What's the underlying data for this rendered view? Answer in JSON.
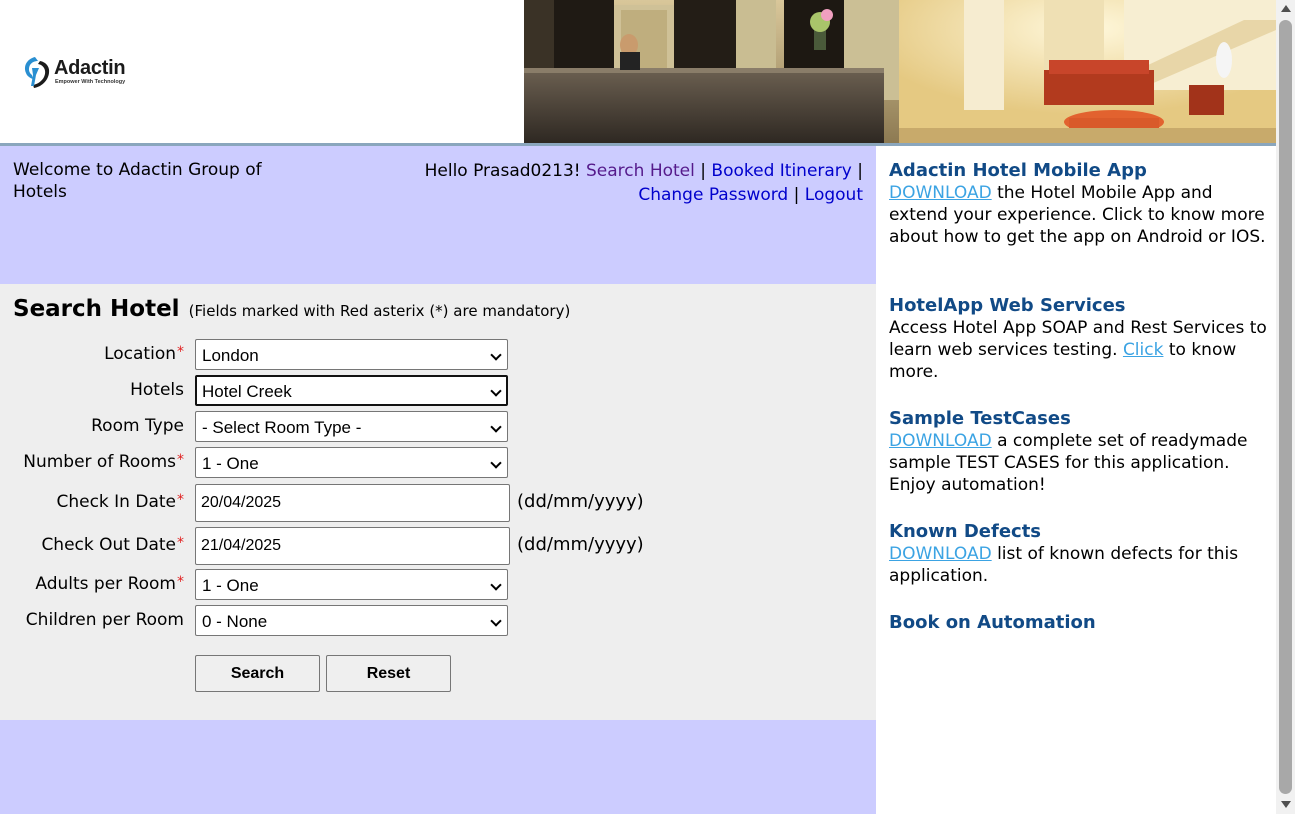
{
  "brand": {
    "name": "Adactin",
    "tagline": "Empower With Technology"
  },
  "welcome": {
    "text": "Welcome to Adactin Group of Hotels"
  },
  "user_nav": {
    "greeting": "Hello Prasad0213!",
    "search_hotel": "Search Hotel",
    "booked_itinerary": "Booked Itinerary",
    "change_password": "Change Password",
    "logout": "Logout",
    "separator": "|"
  },
  "form": {
    "title": "Search Hotel",
    "note": "(Fields marked with Red asterix (*) are mandatory)",
    "required_mark": "*",
    "location": {
      "label": "Location",
      "value": "London"
    },
    "hotels": {
      "label": "Hotels",
      "value": "Hotel Creek"
    },
    "room_type": {
      "label": "Room Type",
      "value": "- Select Room Type -"
    },
    "number_of_rooms": {
      "label": "Number of Rooms",
      "value": "1 - One"
    },
    "check_in": {
      "label": "Check In Date",
      "value": "20/04/2025",
      "format": "(dd/mm/yyyy)"
    },
    "check_out": {
      "label": "Check Out Date",
      "value": "21/04/2025",
      "format": "(dd/mm/yyyy)"
    },
    "adults": {
      "label": "Adults per Room",
      "value": "1 - One"
    },
    "children": {
      "label": "Children per Room",
      "value": "0 - None"
    },
    "search_button": "Search",
    "reset_button": "Reset"
  },
  "sidebar": {
    "mobile_app": {
      "title": "Adactin Hotel Mobile App",
      "link": "DOWNLOAD",
      "text": " the Hotel Mobile App and extend your experience. Click to know more about how to get the app on Android or IOS."
    },
    "web_services": {
      "title": "HotelApp Web Services",
      "text_before": "Access Hotel App SOAP and Rest Services to learn web services testing. ",
      "link": "Click",
      "text_after": " to know more."
    },
    "test_cases": {
      "title": "Sample TestCases",
      "link": "DOWNLOAD",
      "text": " a complete set of readymade sample TEST CASES for this application. Enjoy automation!"
    },
    "known_defects": {
      "title": "Known Defects",
      "link": "DOWNLOAD",
      "text": " list of known defects for this application."
    },
    "book": {
      "title": "Book on Automation"
    }
  },
  "colors": {
    "band": "#ccccff",
    "form_bg": "#eeeeee",
    "sidebar_title": "#114a86",
    "link": "#3ba3e3",
    "nav_link": "#0000cc",
    "required": "#e02020"
  },
  "icons": {
    "logo": "adactin-logo-icon",
    "select_arrow": "chevron-down-icon"
  }
}
